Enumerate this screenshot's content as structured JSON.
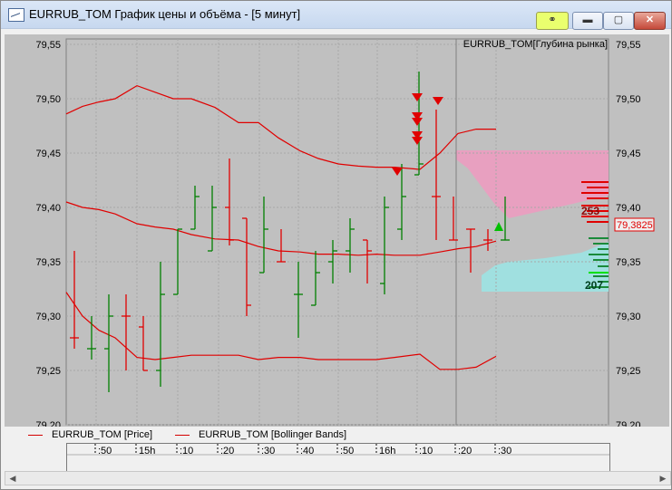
{
  "window": {
    "title": "EURRUB_TOM График цены и объёма - [5 минут]",
    "buttons": {
      "link": "link-icon",
      "minimize": "minimize-icon",
      "maximize": "maximize-icon",
      "close": "close-icon"
    }
  },
  "chart_data": {
    "type": "ohlc",
    "instrument_label": "EURRUB_TOM[Глубина рынка]",
    "y_ticks": [
      "79,20",
      "79,25",
      "79,30",
      "79,35",
      "79,40",
      "79,45",
      "79,50",
      "79,55"
    ],
    "ylim": [
      79.2,
      79.555
    ],
    "x_ticks": [
      ":50",
      "15h",
      ":10",
      ":20",
      ":30",
      ":40",
      ":50",
      "16h",
      ":10",
      ":20",
      ":30"
    ],
    "price_bars": [
      {
        "h": 79.36,
        "l": 79.27,
        "o": 79.28,
        "c": 79.28,
        "color": "red"
      },
      {
        "h": 79.3,
        "l": 79.26,
        "o": 79.27,
        "c": 79.27,
        "color": "green"
      },
      {
        "h": 79.32,
        "l": 79.23,
        "o": 79.27,
        "c": 79.3,
        "color": "green"
      },
      {
        "h": 79.32,
        "l": 79.25,
        "o": 79.3,
        "c": 79.3,
        "color": "red"
      },
      {
        "h": 79.3,
        "l": 79.25,
        "o": 79.29,
        "c": 79.25,
        "color": "red"
      },
      {
        "h": 79.35,
        "l": 79.235,
        "o": 79.25,
        "c": 79.32,
        "color": "green"
      },
      {
        "h": 79.38,
        "l": 79.32,
        "o": 79.32,
        "c": 79.38,
        "color": "green"
      },
      {
        "h": 79.42,
        "l": 79.38,
        "o": 79.38,
        "c": 79.41,
        "color": "green"
      },
      {
        "h": 79.42,
        "l": 79.36,
        "o": 79.36,
        "c": 79.4,
        "color": "green"
      },
      {
        "h": 79.445,
        "l": 79.365,
        "o": 79.4,
        "c": 79.37,
        "color": "red"
      },
      {
        "h": 79.39,
        "l": 79.3,
        "o": 79.39,
        "c": 79.31,
        "color": "red"
      },
      {
        "h": 79.41,
        "l": 79.34,
        "o": 79.34,
        "c": 79.38,
        "color": "green"
      },
      {
        "h": 79.38,
        "l": 79.35,
        "o": 79.35,
        "c": 79.35,
        "color": "red"
      },
      {
        "h": 79.35,
        "l": 79.28,
        "o": 79.32,
        "c": 79.32,
        "color": "green"
      },
      {
        "h": 79.36,
        "l": 79.31,
        "o": 79.31,
        "c": 79.34,
        "color": "green"
      },
      {
        "h": 79.37,
        "l": 79.33,
        "o": 79.35,
        "c": 79.36,
        "color": "green"
      },
      {
        "h": 79.39,
        "l": 79.34,
        "o": 79.36,
        "c": 79.38,
        "color": "green"
      },
      {
        "h": 79.37,
        "l": 79.33,
        "o": 79.37,
        "c": 79.36,
        "color": "red"
      },
      {
        "h": 79.41,
        "l": 79.32,
        "o": 79.33,
        "c": 79.4,
        "color": "green"
      },
      {
        "h": 79.44,
        "l": 79.37,
        "o": 79.38,
        "c": 79.41,
        "color": "green"
      },
      {
        "h": 79.525,
        "l": 79.43,
        "o": 79.43,
        "c": 79.44,
        "color": "green"
      },
      {
        "h": 79.49,
        "l": 79.37,
        "o": 79.41,
        "c": 79.41,
        "color": "red"
      },
      {
        "h": 79.41,
        "l": 79.37,
        "o": 79.37,
        "c": 79.37,
        "color": "red"
      },
      {
        "h": 79.38,
        "l": 79.34,
        "o": 79.38,
        "c": 79.38,
        "color": "red"
      },
      {
        "h": 79.38,
        "l": 79.36,
        "o": 79.37,
        "c": 79.37,
        "color": "red"
      },
      {
        "h": 79.41,
        "l": 79.37,
        "o": 79.37,
        "c": 79.37,
        "color": "green"
      }
    ],
    "bollinger": {
      "upper": [
        79.486,
        79.493,
        79.497,
        79.5,
        79.512,
        79.506,
        79.5,
        79.5,
        79.492,
        79.478,
        79.478,
        79.464,
        79.452,
        79.445,
        79.44,
        79.438,
        79.437,
        79.437,
        79.435,
        79.45,
        79.468,
        79.472,
        79.472,
        79.471
      ],
      "middle": [
        79.405,
        79.4,
        79.398,
        79.394,
        79.385,
        79.382,
        79.38,
        79.375,
        79.371,
        79.37,
        79.364,
        79.36,
        79.359,
        79.357,
        79.357,
        79.356,
        79.357,
        79.356,
        79.356,
        79.359,
        79.362,
        79.364,
        79.369,
        79.372
      ],
      "lower": [
        79.322,
        79.3,
        79.287,
        79.28,
        79.262,
        79.26,
        79.262,
        79.264,
        79.264,
        79.264,
        79.26,
        79.262,
        79.262,
        79.26,
        79.26,
        79.26,
        79.26,
        79.262,
        79.265,
        79.251,
        79.251,
        79.253,
        79.263,
        79.271
      ]
    },
    "depth": {
      "ask_total": "253",
      "bid_total": "207",
      "current_price": "79,3825"
    },
    "legend": [
      "EURRUB_TOM [Price]",
      "EURRUB_TOM [Bollinger Bands]"
    ],
    "colors": {
      "background": "#c0c0c0",
      "line": "#e00000",
      "up": "#008000",
      "ask_area": "#e8a0c0",
      "bid_area": "#a0e0e0"
    }
  }
}
